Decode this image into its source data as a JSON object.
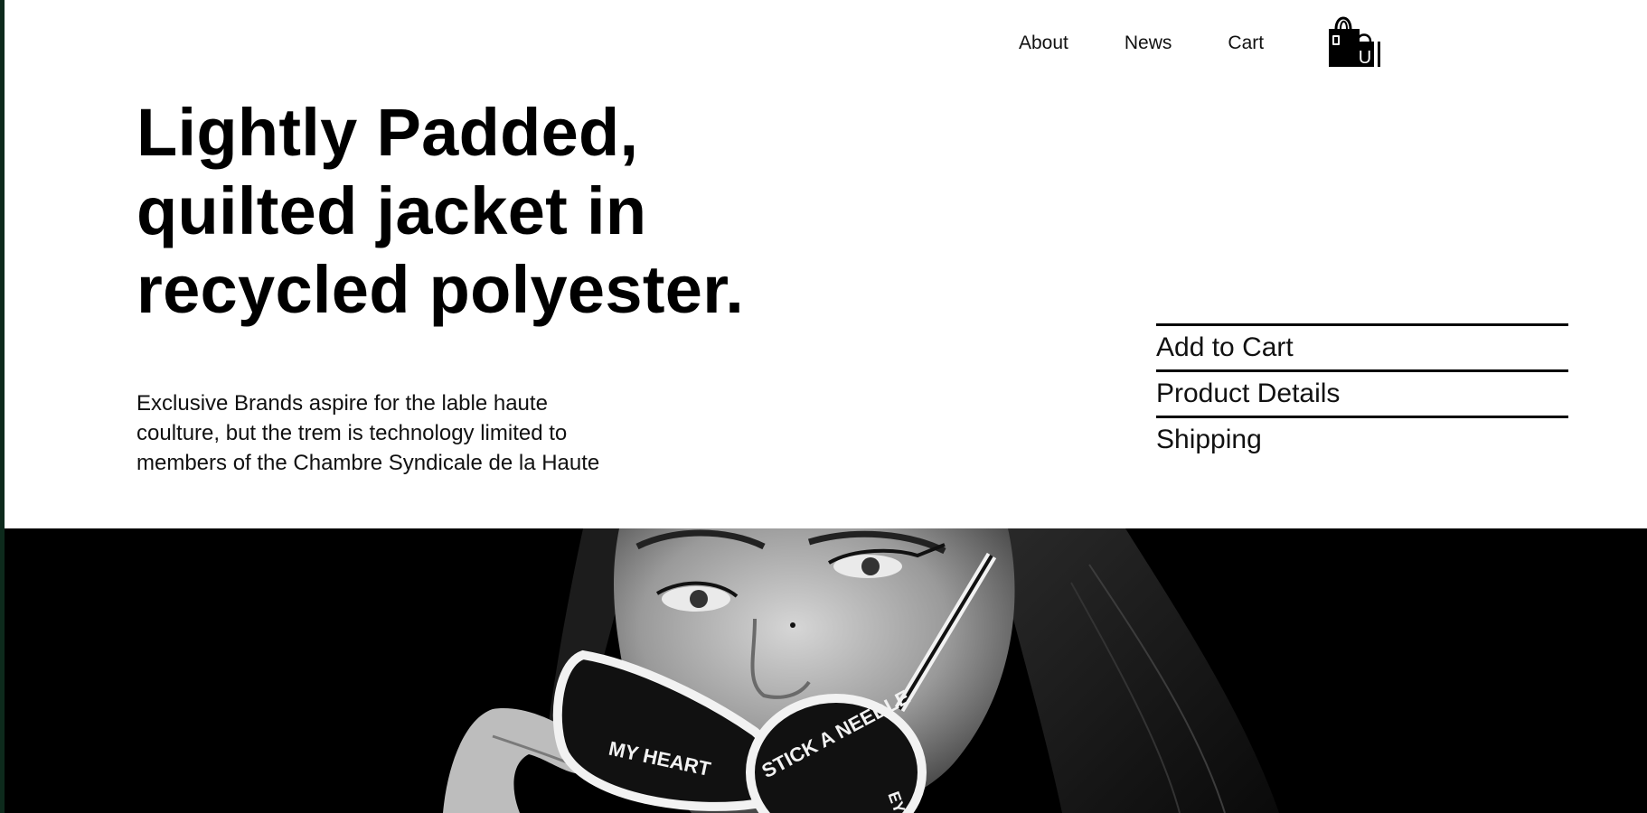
{
  "nav": {
    "about": "About",
    "news": "News",
    "cart": "Cart",
    "bag_icon": "shopping-bag-icon",
    "bag_letter": "U"
  },
  "product": {
    "title_line1": "Lightly Padded,",
    "title_line2": "quilted jacket in",
    "title_line3": "recycled polyester.",
    "desc_line1": "Exclusive Brands aspire for the lable haute",
    "desc_line2": "coulture, but the trem is technology limited to",
    "desc_line3": "members of the Chambre Syndicale de la Haute"
  },
  "actions": {
    "add_to_cart": "Add to Cart",
    "product_details": "Product Details",
    "shipping": "Shipping"
  },
  "hero": {
    "glasses_text_left": "MY HEART",
    "glasses_text_right": "STICK A NEEDLE",
    "glasses_text_bottom": "EYE"
  },
  "colors": {
    "background": "#ffffff",
    "text": "#000000",
    "hero_background": "#000000"
  }
}
